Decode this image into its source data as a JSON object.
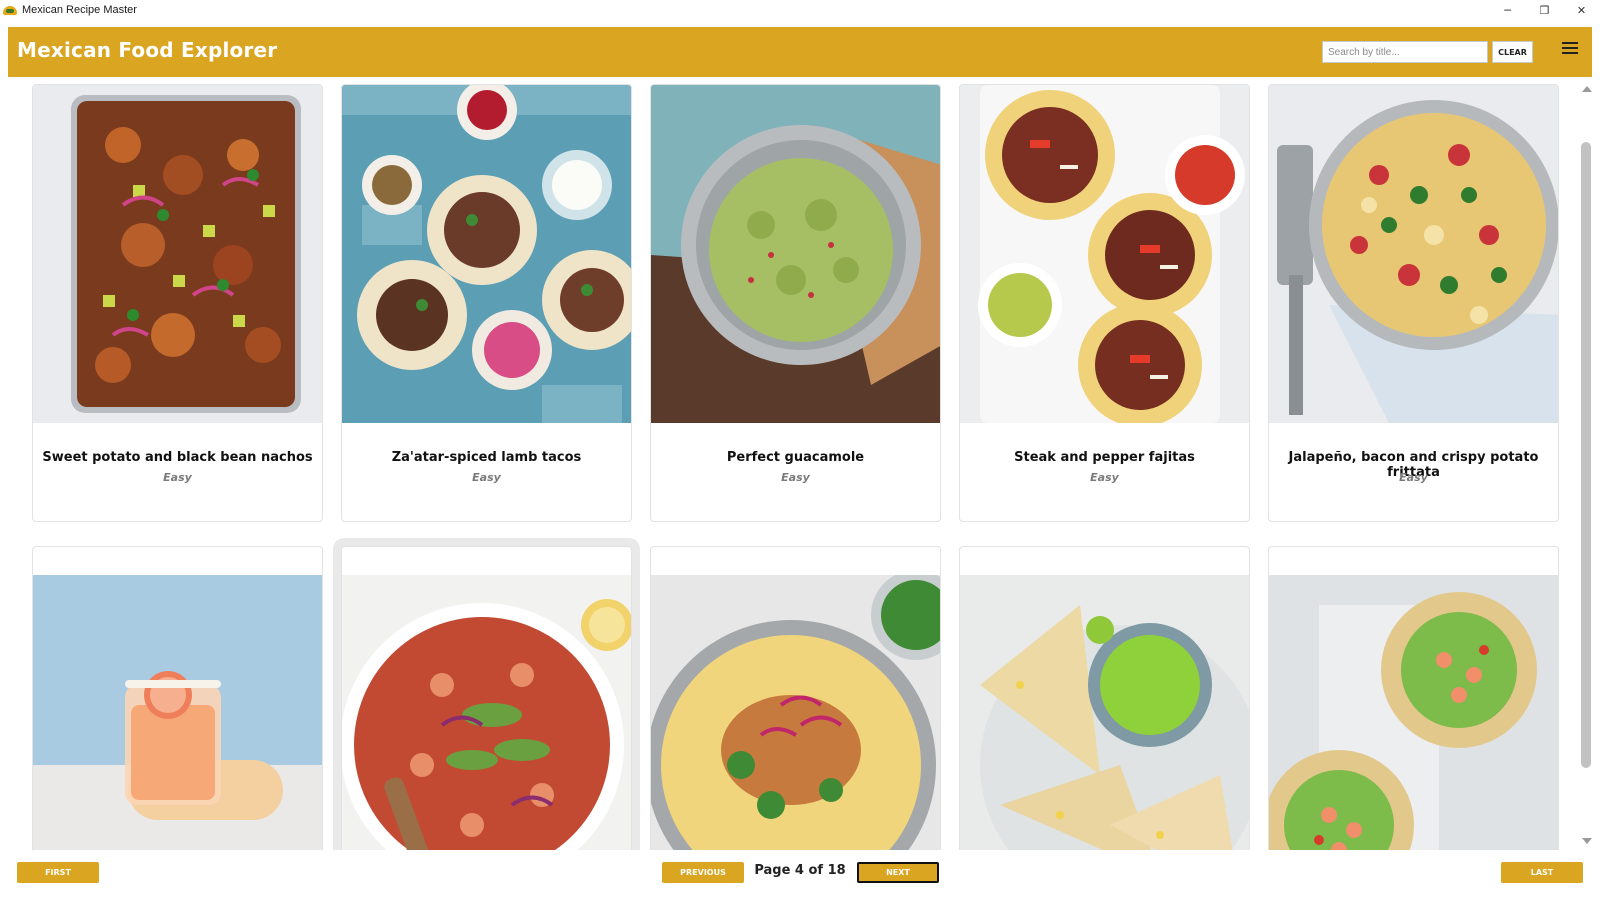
{
  "window": {
    "title": "Mexican Recipe Master",
    "controls": {
      "minimize": "─",
      "restore": "❐",
      "close": "✕"
    }
  },
  "header": {
    "title": "Mexican Food Explorer",
    "search_placeholder": "Search by title...",
    "search_value": "",
    "clear_label": "CLEAR",
    "accent_color": "#daa521"
  },
  "recipes": [
    {
      "title": "Sweet potato and black bean nachos",
      "difficulty": "Easy",
      "image": "nachos-photo"
    },
    {
      "title": "Za'atar-spiced lamb tacos",
      "difficulty": "Easy",
      "image": "lamb-tacos-photo"
    },
    {
      "title": "Perfect guacamole",
      "difficulty": "Easy",
      "image": "guacamole-photo"
    },
    {
      "title": "Steak and pepper fajitas",
      "difficulty": "Easy",
      "image": "fajitas-photo"
    },
    {
      "title": "Jalapeño, bacon and crispy potato frittata",
      "difficulty": "Easy",
      "image": "frittata-photo"
    },
    {
      "title": "",
      "difficulty": "",
      "image": "grapefruit-cocktail-photo"
    },
    {
      "title": "",
      "difficulty": "",
      "image": "mexican-rice-photo"
    },
    {
      "title": "",
      "difficulty": "",
      "image": "fish-taco-photo"
    },
    {
      "title": "",
      "difficulty": "",
      "image": "quesadillas-photo"
    },
    {
      "title": "",
      "difficulty": "",
      "image": "taco-salad-bowls-photo"
    }
  ],
  "pagination": {
    "first_label": "FIRST",
    "previous_label": "PREVIOUS",
    "page_text": "Page 4 of 18",
    "next_label": "NEXT",
    "last_label": "LAST"
  }
}
